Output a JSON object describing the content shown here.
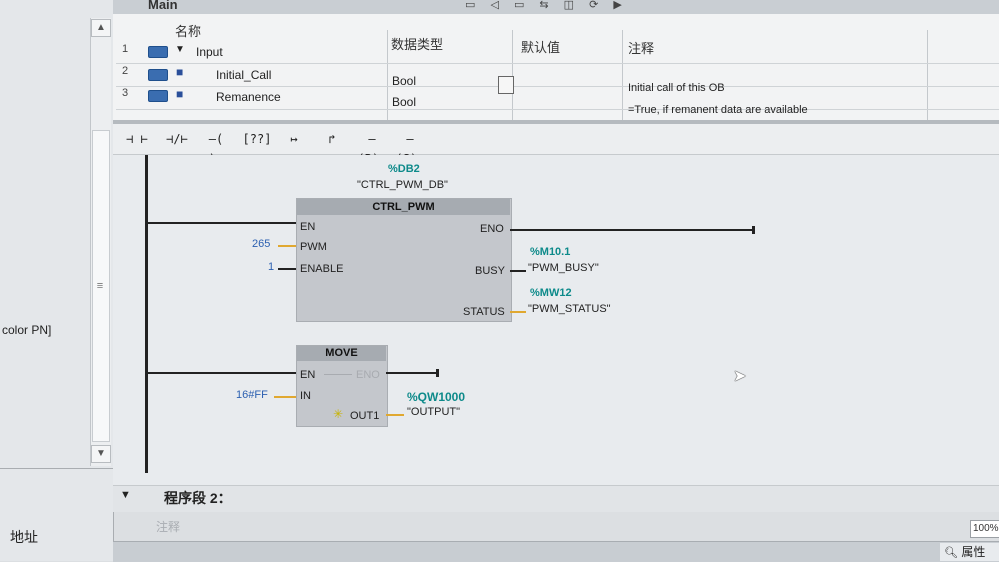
{
  "tree": {
    "selected_label": "color PN]",
    "address_label": "地址"
  },
  "block": {
    "title": "Main"
  },
  "interface": {
    "headers": {
      "name": "名称",
      "datatype": "数据类型",
      "default": "默认值",
      "comment": "注释"
    },
    "rows": [
      {
        "num": "1",
        "name": "Input",
        "type": "",
        "comment": "",
        "expand": "▼"
      },
      {
        "num": "2",
        "name": "Initial_Call",
        "type": "Bool",
        "comment": "Initial call of this OB"
      },
      {
        "num": "3",
        "name": "Remanence",
        "type": "Bool",
        "comment": "=True, if remanent data are available"
      }
    ]
  },
  "toolbar": {
    "items": [
      "⊣ ⊢",
      "⊣/⊢",
      "–( )–",
      "[??]",
      "↦",
      "↱",
      "–(R)–",
      "–(S)–"
    ]
  },
  "network1": {
    "ctrl": {
      "db_address": "%DB2",
      "db_symbol": "\"CTRL_PWM_DB\"",
      "title": "CTRL_PWM",
      "pins": {
        "en": "EN",
        "pwm": "PWM",
        "enable": "ENABLE",
        "eno": "ENO",
        "busy": "BUSY",
        "status": "STATUS"
      },
      "pwm_value": "265",
      "enable_value": "1",
      "busy_address": "%M10.1",
      "busy_symbol": "\"PWM_BUSY\"",
      "status_address": "%MW12",
      "status_symbol": "\"PWM_STATUS\""
    },
    "move": {
      "title": "MOVE",
      "pins": {
        "en": "EN",
        "eno": "ENO",
        "in": "IN",
        "out1": "OUT1"
      },
      "in_value": "16#FF",
      "out_address": "%QW1000",
      "out_symbol": "\"OUTPUT\""
    }
  },
  "segment2": {
    "title": "程序段 2：",
    "comment_placeholder": "注释"
  },
  "zoom": "100%",
  "properties_tab": "属性"
}
